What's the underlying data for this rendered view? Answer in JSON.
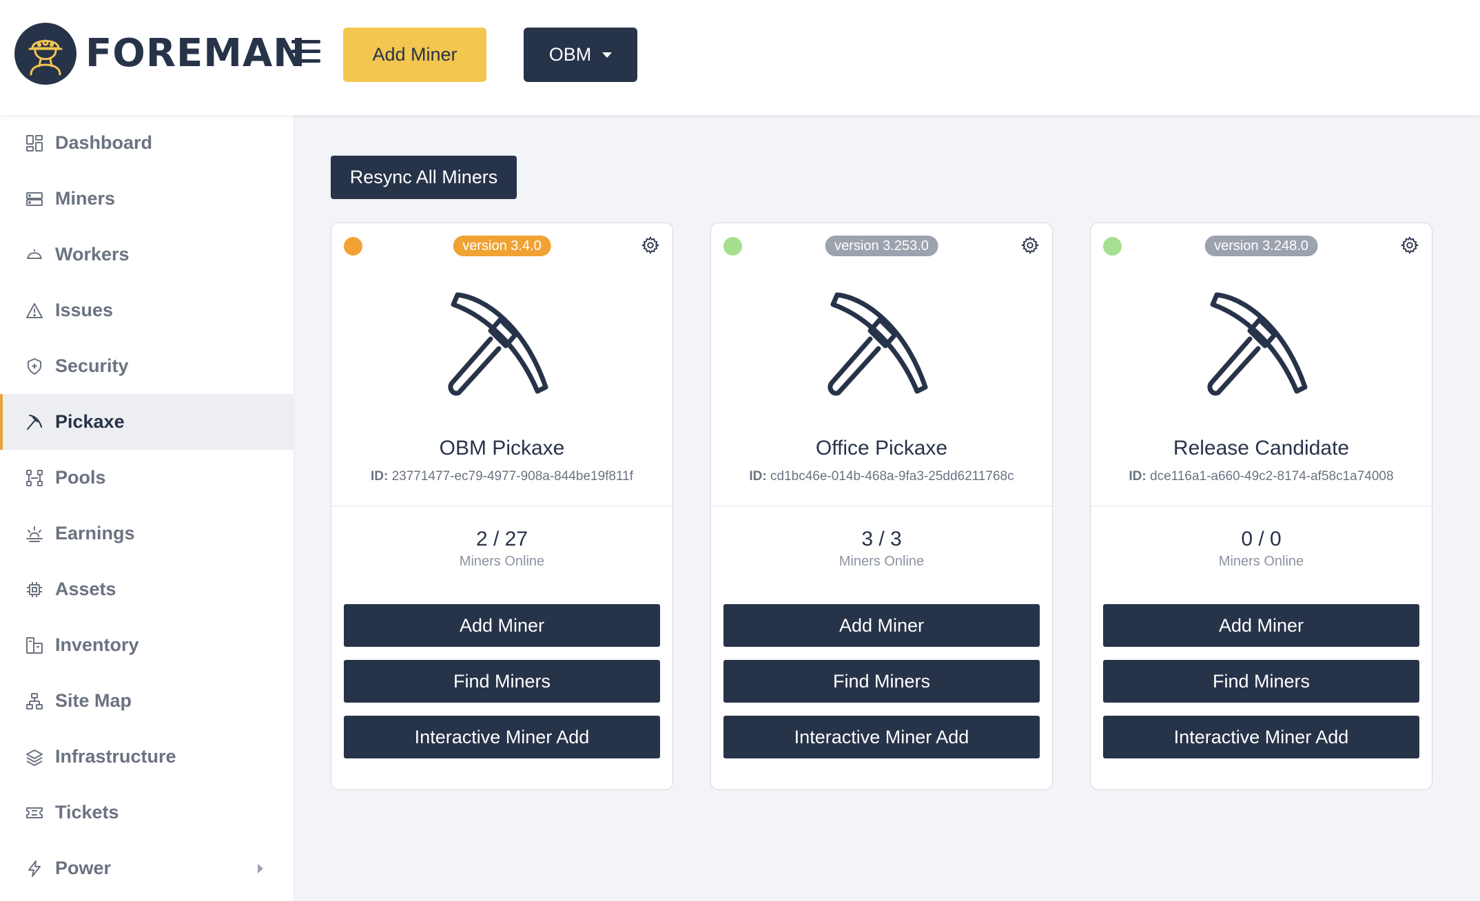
{
  "header": {
    "brand": "FOREMAN",
    "logo_icon": "miner-helmet-icon",
    "menu_icon": "hamburger-icon",
    "add_miner_label": "Add Miner",
    "org_label": "OBM"
  },
  "sidebar": {
    "items": [
      {
        "label": "Dashboard",
        "icon": "dashboard-icon"
      },
      {
        "label": "Miners",
        "icon": "server-icon"
      },
      {
        "label": "Workers",
        "icon": "hardhat-icon"
      },
      {
        "label": "Issues",
        "icon": "warning-icon"
      },
      {
        "label": "Security",
        "icon": "shield-icon"
      },
      {
        "label": "Pickaxe",
        "icon": "pickaxe-icon",
        "active": true
      },
      {
        "label": "Pools",
        "icon": "pools-icon"
      },
      {
        "label": "Earnings",
        "icon": "sunrise-icon"
      },
      {
        "label": "Assets",
        "icon": "chip-icon"
      },
      {
        "label": "Inventory",
        "icon": "boxes-icon"
      },
      {
        "label": "Site Map",
        "icon": "sitemap-icon"
      },
      {
        "label": "Infrastructure",
        "icon": "layers-icon"
      },
      {
        "label": "Tickets",
        "icon": "ticket-icon"
      },
      {
        "label": "Power",
        "icon": "bolt-icon",
        "has_submenu": true
      }
    ]
  },
  "main": {
    "resync_label": "Resync All Miners",
    "cards": [
      {
        "status_color": "#f0a234",
        "version": "version 3.4.0",
        "version_color": "#f0a234",
        "title": "OBM Pickaxe",
        "id_label": "ID:",
        "id": "23771477-ec79-4977-908a-844be19f811f",
        "count": "2 / 27",
        "count_label": "Miners Online",
        "buttons": [
          "Add Miner",
          "Find Miners",
          "Interactive Miner Add"
        ]
      },
      {
        "status_color": "#a6df8f",
        "version": "version 3.253.0",
        "version_color": "#9ca3af",
        "title": "Office Pickaxe",
        "id_label": "ID:",
        "id": "cd1bc46e-014b-468a-9fa3-25dd6211768c",
        "count": "3 / 3",
        "count_label": "Miners Online",
        "buttons": [
          "Add Miner",
          "Find Miners",
          "Interactive Miner Add"
        ]
      },
      {
        "status_color": "#a6df8f",
        "version": "version 3.248.0",
        "version_color": "#9ca3af",
        "title": "Release Candidate",
        "id_label": "ID:",
        "id": "dce116a1-a660-49c2-8174-af58c1a74008",
        "count": "0 / 0",
        "count_label": "Miners Online",
        "buttons": [
          "Add Miner",
          "Find Miners",
          "Interactive Miner Add"
        ]
      }
    ]
  },
  "colors": {
    "navy": "#273349",
    "accent_yellow": "#f2c64f",
    "active_bar": "#e9a23b"
  }
}
